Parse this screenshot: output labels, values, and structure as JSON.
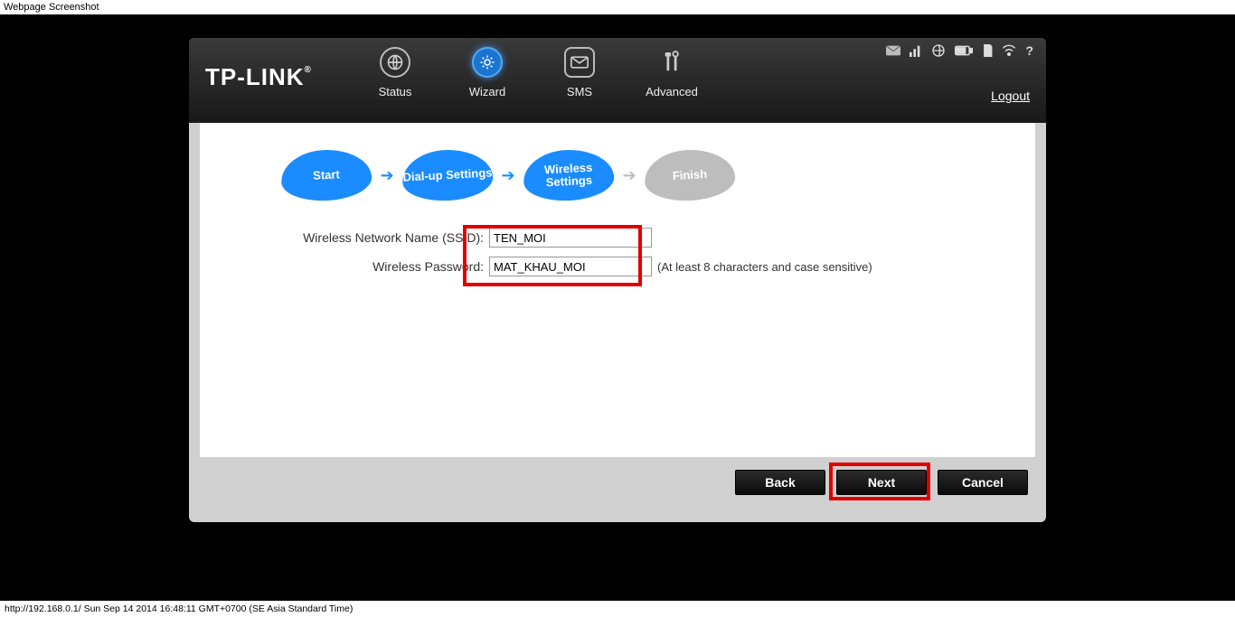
{
  "caption": "Webpage Screenshot",
  "logo": "TP-LINK",
  "nav": {
    "status": "Status",
    "wizard": "Wizard",
    "sms": "SMS",
    "advanced": "Advanced"
  },
  "logout": "Logout",
  "steps": {
    "start": "Start",
    "dialup": "Dial-up Settings",
    "wireless": "Wireless Settings",
    "finish": "Finish"
  },
  "form": {
    "ssid_label": "Wireless Network Name (SSID):",
    "ssid_value": "TEN_MOI",
    "pwd_label": "Wireless Password:",
    "pwd_value": "MAT_KHAU_MOI",
    "pwd_hint": "(At least 8 characters and case sensitive)"
  },
  "buttons": {
    "back": "Back",
    "next": "Next",
    "cancel": "Cancel"
  },
  "footer": "http://192.168.0.1/ Sun Sep 14 2014 16:48:11 GMT+0700 (SE Asia Standard Time)"
}
